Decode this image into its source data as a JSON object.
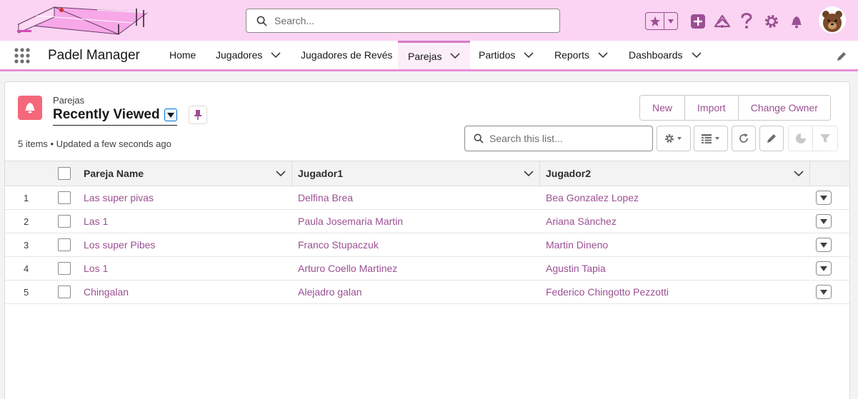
{
  "header": {
    "search_placeholder": "Search..."
  },
  "nav": {
    "app_name": "Padel Manager",
    "items": [
      {
        "label": "Home"
      },
      {
        "label": "Jugadores"
      },
      {
        "label": "Jugadores de Revés"
      },
      {
        "label": "Parejas"
      },
      {
        "label": "Partidos"
      },
      {
        "label": "Reports"
      },
      {
        "label": "Dashboards"
      }
    ]
  },
  "list": {
    "object_label": "Parejas",
    "view_name": "Recently Viewed",
    "meta": "5 items • Updated a few seconds ago",
    "buttons": {
      "new": "New",
      "import": "Import",
      "change_owner": "Change Owner"
    },
    "search_placeholder": "Search this list...",
    "columns": [
      "Pareja Name",
      "Jugador1",
      "Jugador2"
    ],
    "rows": [
      {
        "num": "1",
        "name": "Las super pivas",
        "j1": "Delfina Brea",
        "j2": "Bea Gonzalez Lopez"
      },
      {
        "num": "2",
        "name": "Las 1",
        "j1": "Paula Josemaria Martin",
        "j2": "Ariana Sánchez"
      },
      {
        "num": "3",
        "name": "Los super Pibes",
        "j1": "Franco Stupaczuk",
        "j2": "Martin Dineno"
      },
      {
        "num": "4",
        "name": "Los 1",
        "j1": "Arturo Coello Martinez",
        "j2": "Agustin Tapia"
      },
      {
        "num": "5",
        "name": "Chingalan",
        "j1": "Alejadro galan",
        "j2": "Federico Chingotto Pezzotti"
      }
    ]
  },
  "colors": {
    "header_bg": "#fbd3f3",
    "accent": "#9b4f93",
    "object_icon": "#f4687a"
  }
}
